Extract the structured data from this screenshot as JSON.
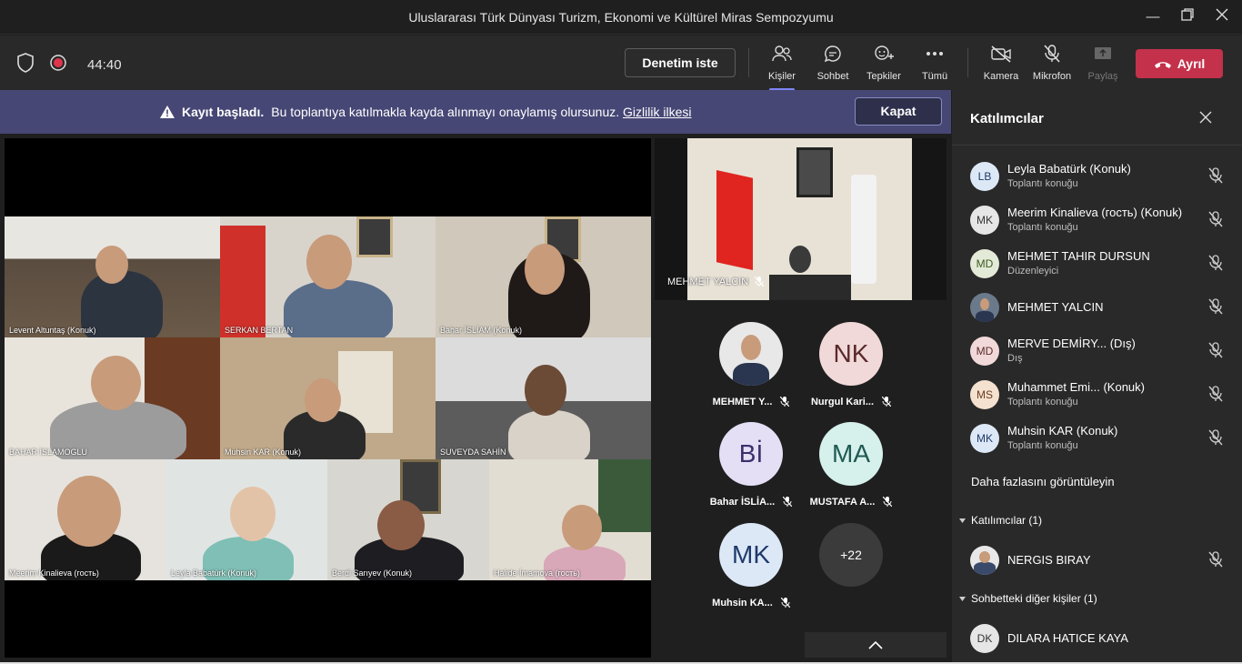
{
  "window": {
    "title": "Uluslararası Türk Dünyası Turizm, Ekonomi ve Kültürel Miras Sempozyumu"
  },
  "toolbar": {
    "timer": "44:40",
    "request_control": "Denetim iste",
    "items": [
      {
        "label": "Kişiler",
        "icon": "people-icon"
      },
      {
        "label": "Sohbet",
        "icon": "chat-icon"
      },
      {
        "label": "Tepkiler",
        "icon": "reactions-icon"
      },
      {
        "label": "Tümü",
        "icon": "more-icon"
      },
      {
        "label": "Kamera",
        "icon": "camera-off-icon"
      },
      {
        "label": "Mikrofon",
        "icon": "mic-off-icon"
      },
      {
        "label": "Paylaş",
        "icon": "share-icon"
      }
    ],
    "leave": "Ayrıl"
  },
  "banner": {
    "bold": "Kayıt başladı.",
    "text": "Bu toplantıya katılmakla kayda alınmayı onaylamış olursunuz.",
    "link": "Gizlilik ilkesi",
    "close": "Kapat"
  },
  "grid": {
    "tiles": [
      "Levent Altuntaş (Konuk)",
      "SERKAN BERTAN",
      "Bahar İSLİAM (Konuk)",
      "BAHAR İSLAMOGLU",
      "Muhsin KAR (Konuk)",
      "SUVEYDA SAHİN",
      "Meerim Kinalieva (гость)",
      "Leyla Babatürk (Konuk)",
      "Berdi Sarıyev (Konuk)",
      "Halide İmamova (гость)"
    ]
  },
  "featured": {
    "name": "MEHMET YALCIN"
  },
  "avatars": [
    {
      "initials": "",
      "name": "MEHMET Y...",
      "color": "#ffffff"
    },
    {
      "initials": "NK",
      "name": "Nurgul Kari...",
      "color": "#f1d9d9"
    },
    {
      "initials": "Bİ",
      "name": "Bahar İSLİA...",
      "color": "#e4dff5"
    },
    {
      "initials": "MA",
      "name": "MUSTAFA A...",
      "color": "#d6f0ec"
    },
    {
      "initials": "MK",
      "name": "Muhsin KA...",
      "color": "#dde8f7"
    },
    {
      "initials": "+22",
      "name": "",
      "color": "#3b3b3b"
    }
  ],
  "panel": {
    "title": "Katılımcılar",
    "participants": [
      {
        "initials": "LB",
        "name": "Leyla Babatürk (Konuk)",
        "role": "Toplantı konuğu",
        "color": "#dde8f7"
      },
      {
        "initials": "MK",
        "name": "Meerim Kinalieva (гость) (Konuk)",
        "role": "Toplantı konuğu",
        "color": "#e6e6e6"
      },
      {
        "initials": "MD",
        "name": "MEHMET TAHIR DURSUN",
        "role": "Düzenleyici",
        "color": "#e3ebd8"
      },
      {
        "initials": "",
        "name": "MEHMET YALCIN",
        "role": "",
        "color": "#6b7a8a"
      },
      {
        "initials": "MD",
        "name": "MERVE DEMİRY...   (Dış)",
        "role": "Dış",
        "color": "#f1d9d9"
      },
      {
        "initials": "MS",
        "name": "Muhammet Emi...   (Konuk)",
        "role": "Toplantı konuğu",
        "color": "#f5e1cf"
      },
      {
        "initials": "MK",
        "name": "Muhsin KAR (Konuk)",
        "role": "Toplantı konuğu",
        "color": "#dde8f7"
      }
    ],
    "more": "Daha fazlasını görüntüleyin",
    "section_attendees": "Katılımcılar (1)",
    "attendee": {
      "name": "NERGIS BIRAY"
    },
    "section_chat": "Sohbetteki diğer kişiler (1)",
    "chat_person": {
      "initials": "DK",
      "name": "DILARA HATICE KAYA"
    }
  }
}
